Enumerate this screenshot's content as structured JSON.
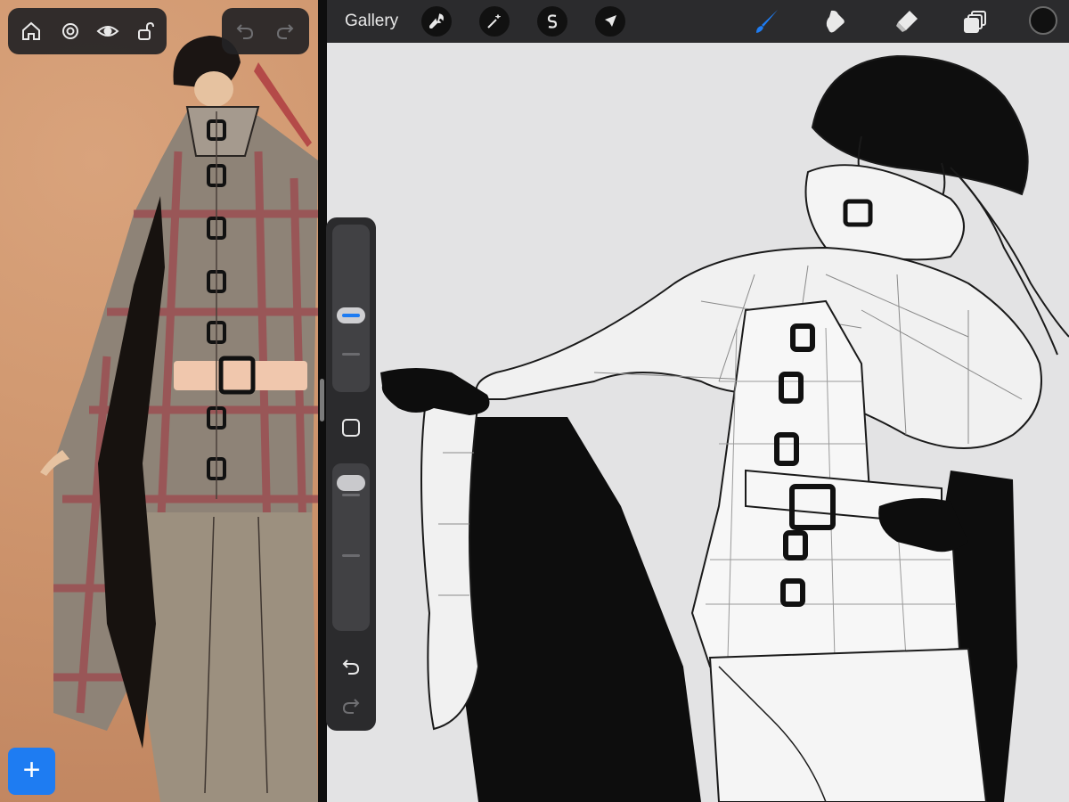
{
  "reference": {
    "toolbar_icons": [
      "home-icon",
      "settings-icon",
      "eye-icon",
      "lock-icon"
    ],
    "history_icons": [
      "undo-icon",
      "redo-icon"
    ],
    "add_button_label": "+"
  },
  "topbar": {
    "gallery_label": "Gallery",
    "action_icons": [
      "wrench-icon",
      "magic-wand-icon",
      "selection-icon",
      "transform-arrow-icon"
    ],
    "tool_icons": [
      "brush-icon",
      "smudge-icon",
      "eraser-icon",
      "layers-icon"
    ],
    "active_tool": "brush-icon",
    "current_color": "#111111"
  },
  "sidebar": {
    "brush_size_level": 0.45,
    "opacity_level": 0.95,
    "icons": [
      "modify-square-icon",
      "undo-icon",
      "redo-icon"
    ]
  },
  "colors": {
    "accent": "#1e7cf2",
    "toolbar_bg": "#2b2b2d",
    "canvas_bg": "#e3e3e4"
  }
}
